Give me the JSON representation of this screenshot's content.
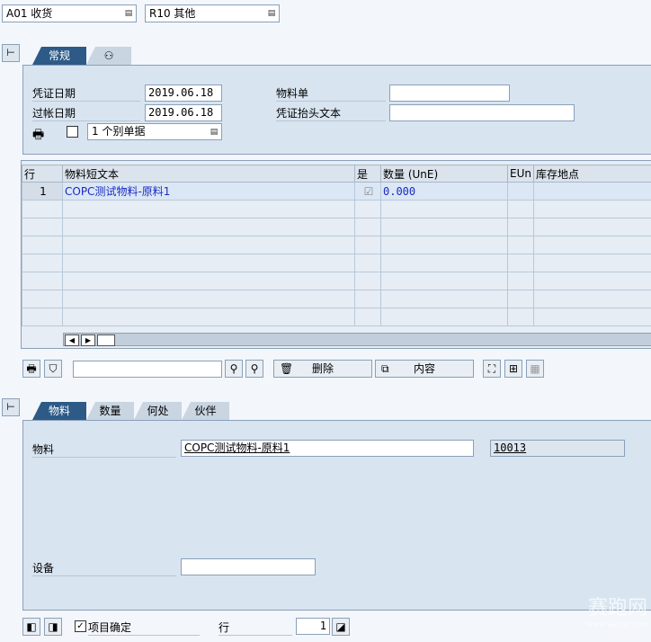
{
  "top": {
    "movement_type": "A01 收货",
    "reference": "R10 其他"
  },
  "header_tabs": [
    {
      "label": "常规"
    },
    {
      "label": ""
    }
  ],
  "header": {
    "doc_date_label": "凭证日期",
    "doc_date": "2019.06.18",
    "post_date_label": "过帐日期",
    "post_date": "2019.06.18",
    "material_slip_label": "物料单",
    "material_slip": "",
    "header_text_label": "凭证抬头文本",
    "header_text": "",
    "slip_type": "1 个别单据"
  },
  "items_table": {
    "columns": [
      "行",
      "物料短文本",
      "是",
      "数量 (UnE)",
      "EUn",
      "库存地点"
    ],
    "rows": [
      {
        "line": "1",
        "text": "COPC测试物料-原料1",
        "checked": true,
        "qty": "0.000",
        "eun": "",
        "sloc": ""
      }
    ]
  },
  "toolbar": {
    "search_value": "",
    "delete_label": "删除",
    "content_label": "内容"
  },
  "detail_tabs": [
    {
      "label": "物料"
    },
    {
      "label": "数量"
    },
    {
      "label": "何处"
    },
    {
      "label": "伙伴"
    }
  ],
  "detail": {
    "material_label": "物料",
    "material_text": "COPC测试物料-原料1",
    "material_code": "10013",
    "equipment_label": "设备",
    "equipment_value": ""
  },
  "footer": {
    "item_ok_label": "项目确定",
    "line_label": "行",
    "line_value": "1"
  },
  "watermark": {
    "text": "赛跑网",
    "url": "www.saipao.com"
  }
}
